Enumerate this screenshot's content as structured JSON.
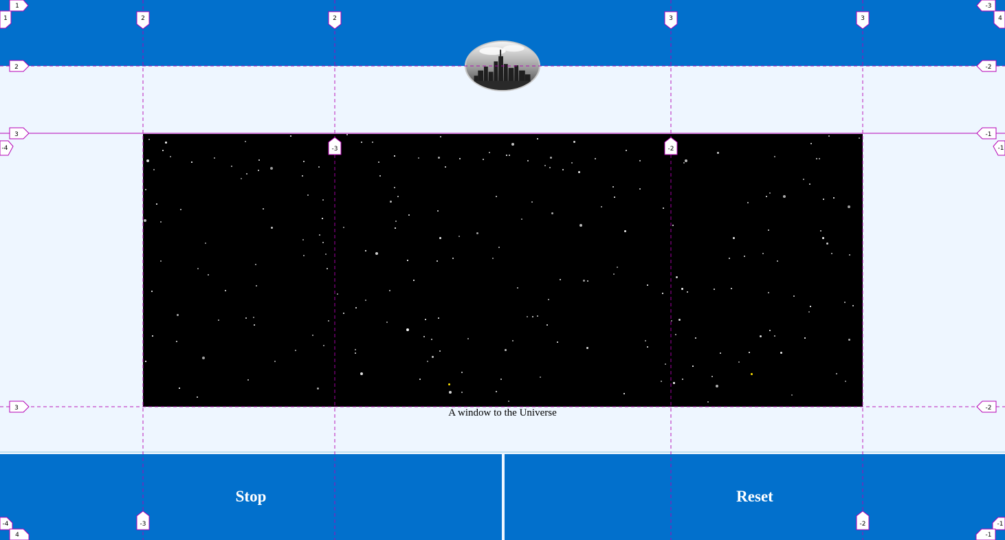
{
  "header": {
    "logo": "city-skyline-logo"
  },
  "sky": {
    "caption": "A window to the Universe",
    "star_color": "#ffffff",
    "highlight_color": "#ffe300"
  },
  "controls": {
    "stop_label": "Stop",
    "reset_label": "Reset"
  },
  "guides": {
    "top_markers": [
      "1",
      "2",
      "2",
      "3",
      "3",
      "-3",
      "4"
    ],
    "left_markers": [
      "1",
      "2",
      "3",
      "-4",
      "3",
      "-4",
      "4"
    ],
    "right_markers": [
      "-2",
      "-1",
      "-1",
      "-2",
      "-1",
      "-1"
    ],
    "inner_markers": [
      "-3",
      "-2"
    ],
    "bottom_markers": [
      "-3",
      "-2"
    ]
  },
  "colors": {
    "header": "#0270cc",
    "page": "#eef6ff",
    "guide": "#b400b4"
  }
}
